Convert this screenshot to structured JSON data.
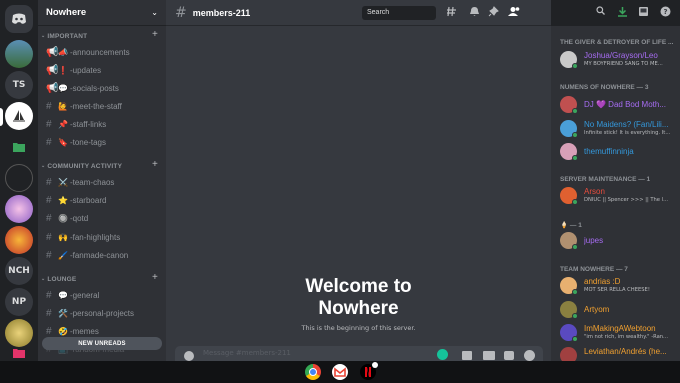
{
  "server": {
    "name": "Nowhere",
    "rail": [
      {
        "label": "",
        "icon": "discord-home-icon"
      },
      {
        "label": "",
        "icon": "landscape-server-icon"
      },
      {
        "label": "TS",
        "icon": ""
      },
      {
        "label": "",
        "icon": "sailboat-server-icon"
      },
      {
        "label": "",
        "icon": "folder-icon"
      },
      {
        "label": "",
        "icon": "nowhere-server-icon"
      },
      {
        "label": "",
        "icon": "anime-server-icon"
      },
      {
        "label": "",
        "icon": "red-server-icon"
      },
      {
        "label": "NCH",
        "icon": ""
      },
      {
        "label": "NP",
        "icon": ""
      },
      {
        "label": "",
        "icon": "art-server-icon"
      },
      {
        "label": "",
        "icon": "folder-icon"
      }
    ]
  },
  "sidebar": {
    "categories": [
      {
        "name": "IMPORTANT"
      },
      {
        "name": "COMMUNITY ACTIVITY"
      },
      {
        "name": "LOUNGE"
      }
    ],
    "channels": [
      {
        "emoji": "📣",
        "name": "-announcements",
        "type": "announcement"
      },
      {
        "emoji": "❗",
        "name": "-updates",
        "type": "announcement"
      },
      {
        "emoji": "💬",
        "name": "-socials-posts",
        "type": "announcement"
      },
      {
        "emoji": "🙋",
        "name": "-meet-the-staff",
        "type": "text"
      },
      {
        "emoji": "📌",
        "name": "-staff-links",
        "type": "text"
      },
      {
        "emoji": "🔖",
        "name": "-tone-tags",
        "type": "text"
      },
      {
        "emoji": "⚔️",
        "name": "-team-chaos",
        "type": "text"
      },
      {
        "emoji": "⭐",
        "name": "-starboard",
        "type": "text"
      },
      {
        "emoji": "🔘",
        "name": "-qotd",
        "type": "text"
      },
      {
        "emoji": "🙌",
        "name": "-fan-highlights",
        "type": "text"
      },
      {
        "emoji": "🖌️",
        "name": "-fanmade-canon",
        "type": "text"
      },
      {
        "emoji": "💬",
        "name": "-general",
        "type": "text"
      },
      {
        "emoji": "🛠️",
        "name": "-personal-projects",
        "type": "text"
      },
      {
        "emoji": "🤣",
        "name": "-memes",
        "type": "text"
      },
      {
        "emoji": "📺",
        "name": "-random-media",
        "type": "text"
      }
    ],
    "new_unreads": "NEW UNREADS"
  },
  "main": {
    "channel_name": "members-211",
    "search_placeholder": "Search",
    "welcome_title_line1": "Welcome to",
    "welcome_title_line2": "Nowhere",
    "welcome_sub": "This is the beginning of this server.",
    "message_placeholder": "Message #members-211"
  },
  "members": {
    "groups": [
      {
        "title": "THE GIVER & DETROYER OF LIFE ...",
        "count": ""
      },
      {
        "title": "NUMENS OF NOWHERE — 3",
        "count": "3"
      },
      {
        "title": "SERVER MAINTENANCE — 1",
        "count": "1"
      },
      {
        "title": "🍦 — 1",
        "count": "1"
      },
      {
        "title": "TEAM NOWHERE — 7",
        "count": "7"
      }
    ],
    "list": [
      {
        "name": "Joshua/Grayson/Leo",
        "status": "MY BOYFRIEND SANG TO ME...",
        "color": "#a66cf2"
      },
      {
        "name": "DJ 💜 Dad Bod Moth...",
        "status": "",
        "color": "#a66cf2"
      },
      {
        "name": "No Maidens? (Fan/Lili...",
        "status": "Infinite stick! It is everything. It...",
        "color": "#3498db"
      },
      {
        "name": "themuffinninja",
        "status": "",
        "color": "#3498db"
      },
      {
        "name": "Arson",
        "status": "DNIUC || Spencer >>> || The l...",
        "color": "#e74c3c"
      },
      {
        "name": "jupes",
        "status": "",
        "color": "#a66cf2"
      },
      {
        "name": "andrias :D",
        "status": "MOT SER RELLA CHEESE!",
        "color": "#f0a030"
      },
      {
        "name": "Artyom",
        "status": "",
        "color": "#f0a030"
      },
      {
        "name": "ImMakingAWebtoon",
        "status": "\"im not rich, im wealthy.\" -Ran...",
        "color": "#f0a030"
      },
      {
        "name": "Leviathan/Andrés (he...",
        "status": "",
        "color": "#f0a030"
      }
    ]
  },
  "taskbar": {
    "apps": [
      "chrome-icon",
      "gmail-icon",
      "netflix-icon"
    ]
  },
  "colors": {
    "accent": "#5865f2",
    "online": "#3ba55d",
    "download": "#3ba55d"
  }
}
